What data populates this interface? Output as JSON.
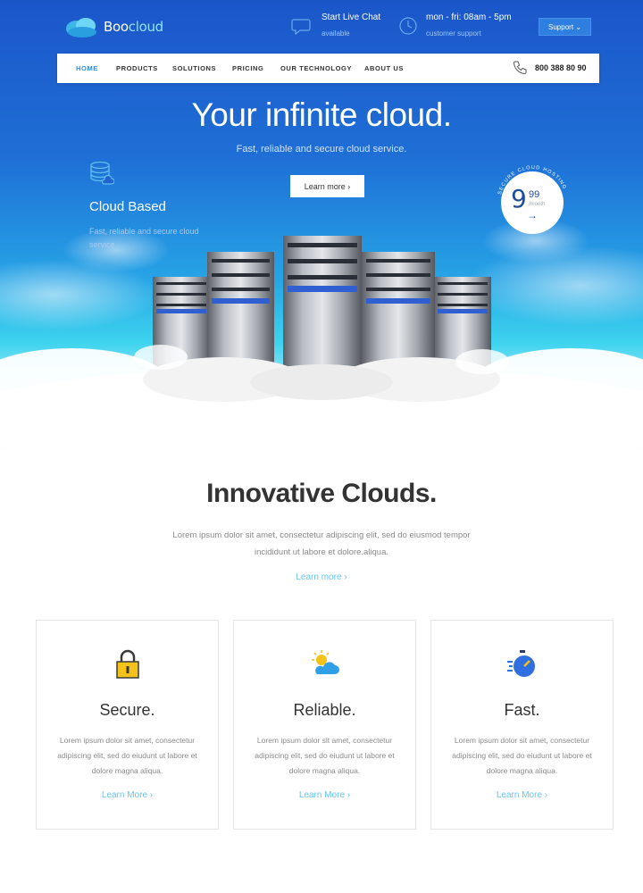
{
  "brand": {
    "name_main": "Boo",
    "name_accent": "cloud"
  },
  "topbar": {
    "chat": {
      "title": "Start Live Chat",
      "sub": "available"
    },
    "hours": {
      "title": "mon - fri: 08am - 5pm",
      "sub": "customer support"
    },
    "support_label": "Support ⌄"
  },
  "nav": {
    "items": [
      "HOME",
      "PRODUCTS",
      "SOLUTIONS",
      "PRICING",
      "OUR TECHNOLOGY",
      "ABOUT US"
    ],
    "phone": "800 388 80 90"
  },
  "hero": {
    "title": "Your infinite cloud.",
    "subtitle": "Fast, reliable and secure cloud service.",
    "button": "Learn more  ›",
    "feature_title": "Cloud Based",
    "feature_text": "Fast, reliable and secure cloud service.",
    "badge": {
      "arc_text": "SECURE CLOUD HOSTING",
      "price": "9",
      "cents": "99",
      "period": "/month",
      "arrow": "→"
    }
  },
  "section": {
    "title": "Innovative Clouds.",
    "text": "Lorem ipsum dolor sit amet, consectetur adipiscing elit, sed do eiusmod tempor incididunt ut labore et dolore.aliqua.",
    "link": "Learn more  ›"
  },
  "cards": [
    {
      "title": "Secure.",
      "text": "Lorem ipsum dolor sit amet, consectetur adipiscing elit, sed do eiudunt ut labore et dolore magna aliqua.",
      "link": "Learn More  ›",
      "icon": "padlock-icon"
    },
    {
      "title": "Reliable.",
      "text": "Lorem ipsum dolor sit amet, consectetur adipiscing elit, sed do eiudunt ut labore et dolore magna aliqua.",
      "link": "Learn More  ›",
      "icon": "sun-cloud-icon"
    },
    {
      "title": "Fast.",
      "text": "Lorem ipsum dolor sit amet, consectetur adipiscing elit, sed do eiudunt ut labore et dolore magna aliqua.",
      "link": "Learn More  ›",
      "icon": "stopwatch-icon"
    }
  ],
  "colors": {
    "accent": "#2a8fe6",
    "link": "#67c4ef",
    "hero_top": "#1b56c9",
    "hero_mid": "#26a4e6"
  }
}
